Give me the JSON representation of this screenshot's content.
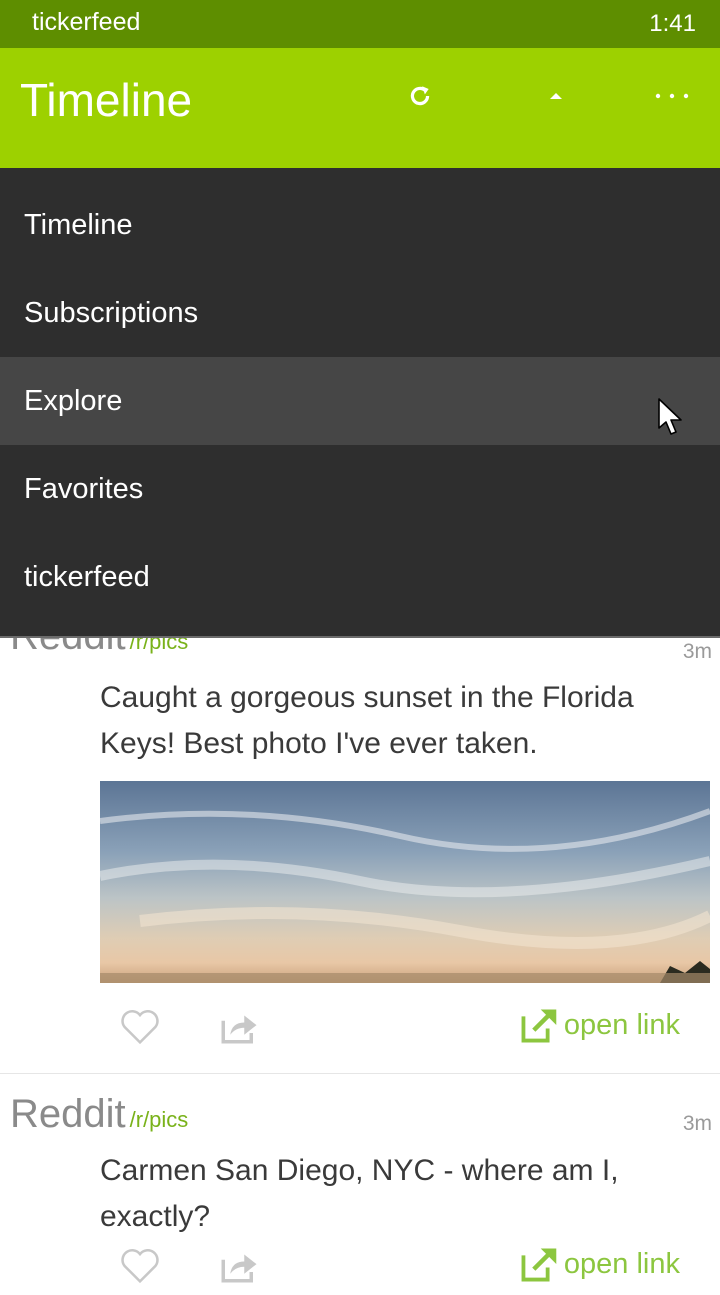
{
  "status_bar": {
    "app_name": "tickerfeed",
    "time": "1:41"
  },
  "app_bar": {
    "title": "Timeline",
    "icons": [
      "refresh-icon",
      "scroll-up-icon",
      "more-icon"
    ]
  },
  "nav_menu": {
    "items": [
      {
        "label": "Timeline"
      },
      {
        "label": "Subscriptions"
      },
      {
        "label": "Explore",
        "hovered": true
      },
      {
        "label": "Favorites"
      },
      {
        "label": "tickerfeed"
      }
    ]
  },
  "feed": {
    "posts": [
      {
        "source": "Reddit",
        "subreddit": "/r/pics",
        "time": "3m",
        "text": "Caught a gorgeous sunset in the Florida Keys! Best photo I've ever taken.",
        "has_image": true,
        "open_link_label": "open link"
      },
      {
        "source": "Reddit",
        "subreddit": "/r/pics",
        "time": "3m",
        "text": "Carmen San Diego, NYC - where am I, exactly?",
        "open_link_label": "open link"
      }
    ]
  },
  "colors": {
    "status_bar": "#5e8e00",
    "app_bar": "#9dd100",
    "menu_bg": "#2e2e2e",
    "menu_hover": "#464646",
    "accent_link": "#8cc63f"
  }
}
